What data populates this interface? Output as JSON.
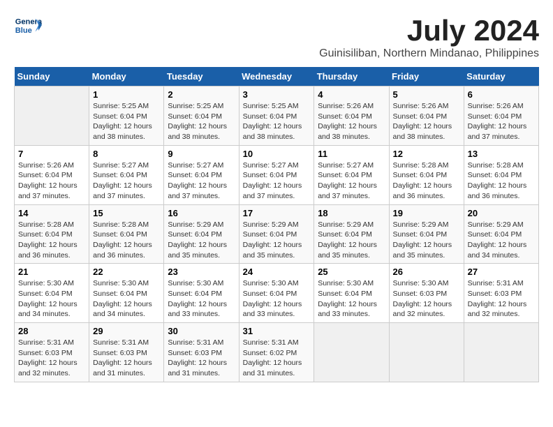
{
  "logo": {
    "line1": "General",
    "line2": "Blue"
  },
  "title": "July 2024",
  "subtitle": "Guinisiliban, Northern Mindanao, Philippines",
  "headers": [
    "Sunday",
    "Monday",
    "Tuesday",
    "Wednesday",
    "Thursday",
    "Friday",
    "Saturday"
  ],
  "weeks": [
    [
      {
        "day": "",
        "info": ""
      },
      {
        "day": "1",
        "info": "Sunrise: 5:25 AM\nSunset: 6:04 PM\nDaylight: 12 hours\nand 38 minutes."
      },
      {
        "day": "2",
        "info": "Sunrise: 5:25 AM\nSunset: 6:04 PM\nDaylight: 12 hours\nand 38 minutes."
      },
      {
        "day": "3",
        "info": "Sunrise: 5:25 AM\nSunset: 6:04 PM\nDaylight: 12 hours\nand 38 minutes."
      },
      {
        "day": "4",
        "info": "Sunrise: 5:26 AM\nSunset: 6:04 PM\nDaylight: 12 hours\nand 38 minutes."
      },
      {
        "day": "5",
        "info": "Sunrise: 5:26 AM\nSunset: 6:04 PM\nDaylight: 12 hours\nand 38 minutes."
      },
      {
        "day": "6",
        "info": "Sunrise: 5:26 AM\nSunset: 6:04 PM\nDaylight: 12 hours\nand 37 minutes."
      }
    ],
    [
      {
        "day": "7",
        "info": "Sunrise: 5:26 AM\nSunset: 6:04 PM\nDaylight: 12 hours\nand 37 minutes."
      },
      {
        "day": "8",
        "info": "Sunrise: 5:27 AM\nSunset: 6:04 PM\nDaylight: 12 hours\nand 37 minutes."
      },
      {
        "day": "9",
        "info": "Sunrise: 5:27 AM\nSunset: 6:04 PM\nDaylight: 12 hours\nand 37 minutes."
      },
      {
        "day": "10",
        "info": "Sunrise: 5:27 AM\nSunset: 6:04 PM\nDaylight: 12 hours\nand 37 minutes."
      },
      {
        "day": "11",
        "info": "Sunrise: 5:27 AM\nSunset: 6:04 PM\nDaylight: 12 hours\nand 37 minutes."
      },
      {
        "day": "12",
        "info": "Sunrise: 5:28 AM\nSunset: 6:04 PM\nDaylight: 12 hours\nand 36 minutes."
      },
      {
        "day": "13",
        "info": "Sunrise: 5:28 AM\nSunset: 6:04 PM\nDaylight: 12 hours\nand 36 minutes."
      }
    ],
    [
      {
        "day": "14",
        "info": "Sunrise: 5:28 AM\nSunset: 6:04 PM\nDaylight: 12 hours\nand 36 minutes."
      },
      {
        "day": "15",
        "info": "Sunrise: 5:28 AM\nSunset: 6:04 PM\nDaylight: 12 hours\nand 36 minutes."
      },
      {
        "day": "16",
        "info": "Sunrise: 5:29 AM\nSunset: 6:04 PM\nDaylight: 12 hours\nand 35 minutes."
      },
      {
        "day": "17",
        "info": "Sunrise: 5:29 AM\nSunset: 6:04 PM\nDaylight: 12 hours\nand 35 minutes."
      },
      {
        "day": "18",
        "info": "Sunrise: 5:29 AM\nSunset: 6:04 PM\nDaylight: 12 hours\nand 35 minutes."
      },
      {
        "day": "19",
        "info": "Sunrise: 5:29 AM\nSunset: 6:04 PM\nDaylight: 12 hours\nand 35 minutes."
      },
      {
        "day": "20",
        "info": "Sunrise: 5:29 AM\nSunset: 6:04 PM\nDaylight: 12 hours\nand 34 minutes."
      }
    ],
    [
      {
        "day": "21",
        "info": "Sunrise: 5:30 AM\nSunset: 6:04 PM\nDaylight: 12 hours\nand 34 minutes."
      },
      {
        "day": "22",
        "info": "Sunrise: 5:30 AM\nSunset: 6:04 PM\nDaylight: 12 hours\nand 34 minutes."
      },
      {
        "day": "23",
        "info": "Sunrise: 5:30 AM\nSunset: 6:04 PM\nDaylight: 12 hours\nand 33 minutes."
      },
      {
        "day": "24",
        "info": "Sunrise: 5:30 AM\nSunset: 6:04 PM\nDaylight: 12 hours\nand 33 minutes."
      },
      {
        "day": "25",
        "info": "Sunrise: 5:30 AM\nSunset: 6:04 PM\nDaylight: 12 hours\nand 33 minutes."
      },
      {
        "day": "26",
        "info": "Sunrise: 5:30 AM\nSunset: 6:03 PM\nDaylight: 12 hours\nand 32 minutes."
      },
      {
        "day": "27",
        "info": "Sunrise: 5:31 AM\nSunset: 6:03 PM\nDaylight: 12 hours\nand 32 minutes."
      }
    ],
    [
      {
        "day": "28",
        "info": "Sunrise: 5:31 AM\nSunset: 6:03 PM\nDaylight: 12 hours\nand 32 minutes."
      },
      {
        "day": "29",
        "info": "Sunrise: 5:31 AM\nSunset: 6:03 PM\nDaylight: 12 hours\nand 31 minutes."
      },
      {
        "day": "30",
        "info": "Sunrise: 5:31 AM\nSunset: 6:03 PM\nDaylight: 12 hours\nand 31 minutes."
      },
      {
        "day": "31",
        "info": "Sunrise: 5:31 AM\nSunset: 6:02 PM\nDaylight: 12 hours\nand 31 minutes."
      },
      {
        "day": "",
        "info": ""
      },
      {
        "day": "",
        "info": ""
      },
      {
        "day": "",
        "info": ""
      }
    ]
  ]
}
